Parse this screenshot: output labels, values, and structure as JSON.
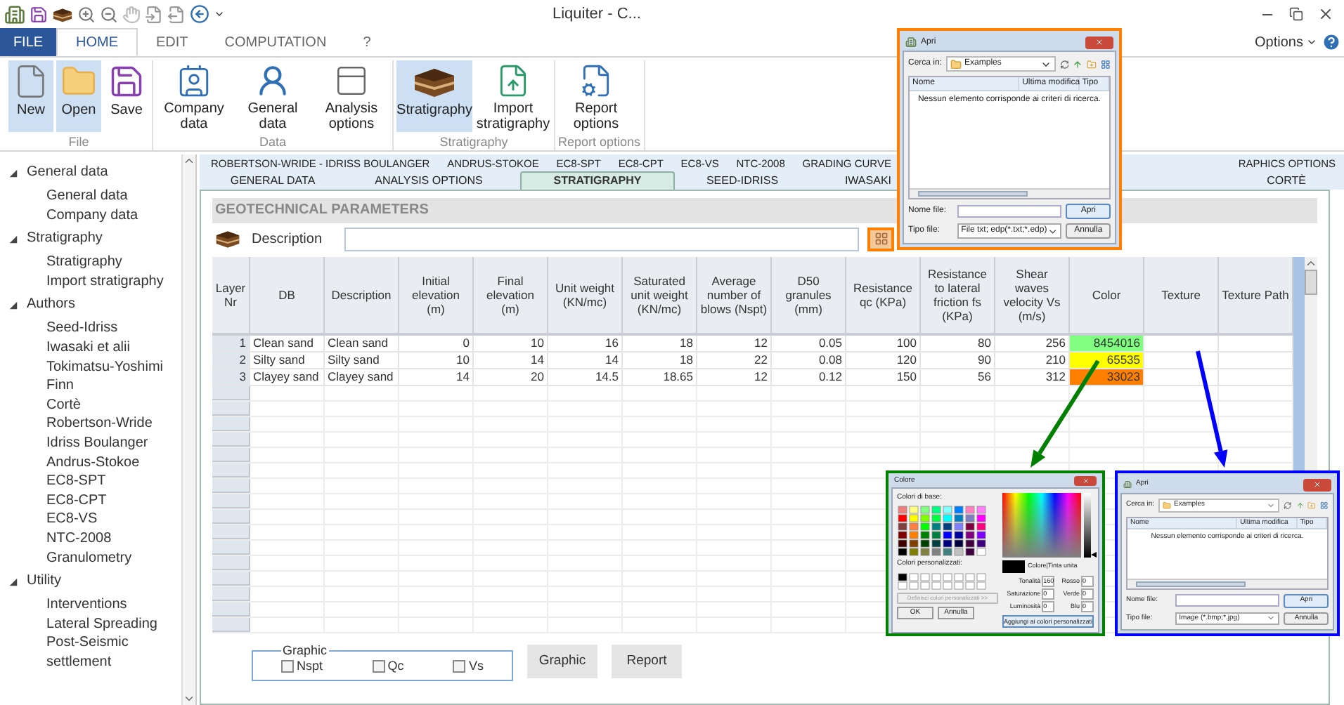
{
  "window": {
    "title": "Liquiter - C..."
  },
  "ribbon_tabs": [
    {
      "label": "FILE",
      "kind": "file",
      "selected": false
    },
    {
      "label": "HOME",
      "kind": "tab",
      "selected": true
    },
    {
      "label": "EDIT",
      "kind": "tab",
      "selected": false
    },
    {
      "label": "COMPUTATION",
      "kind": "tab",
      "selected": false
    },
    {
      "label": "?",
      "kind": "tab",
      "selected": false
    }
  ],
  "options_menu": "Options",
  "ribbon_groups": [
    {
      "label": "File",
      "buttons": [
        {
          "label": "New",
          "selected": true
        },
        {
          "label": "Open",
          "selected": true
        },
        {
          "label": "Save",
          "selected": false
        }
      ]
    },
    {
      "label": "Data",
      "buttons": [
        {
          "label": "Company data",
          "selected": false
        },
        {
          "label": "General data",
          "selected": false
        },
        {
          "label": "Analysis options",
          "selected": false
        }
      ]
    },
    {
      "label": "Stratigraphy",
      "buttons": [
        {
          "label": "Stratigraphy",
          "selected": true
        },
        {
          "label": "Import stratigraphy",
          "selected": false
        }
      ]
    },
    {
      "label": "Report options",
      "buttons": [
        {
          "label": "Report options",
          "selected": false
        }
      ]
    }
  ],
  "sidebar": [
    {
      "label": "General data",
      "expanded": true,
      "children": [
        {
          "label": "General data"
        },
        {
          "label": "Company data"
        }
      ]
    },
    {
      "label": "Stratigraphy",
      "expanded": true,
      "children": [
        {
          "label": "Stratigraphy"
        },
        {
          "label": "Import stratigraphy"
        }
      ]
    },
    {
      "label": "Authors",
      "expanded": true,
      "children": [
        {
          "label": "Seed-Idriss"
        },
        {
          "label": "Iwasaki et alii"
        },
        {
          "label": "Tokimatsu-Yoshimi"
        },
        {
          "label": "Finn"
        },
        {
          "label": "Cortè"
        },
        {
          "label": "Robertson-Wride Idriss Boulanger"
        },
        {
          "label": "Andrus-Stokoe"
        },
        {
          "label": "EC8-SPT"
        },
        {
          "label": "EC8-CPT"
        },
        {
          "label": "EC8-VS"
        },
        {
          "label": "NTC-2008"
        },
        {
          "label": "Granulometry"
        }
      ]
    },
    {
      "label": "Utility",
      "expanded": true,
      "children": [
        {
          "label": "Interventions"
        },
        {
          "label": "Lateral Spreading"
        },
        {
          "label": "Post-Seismic settlement"
        }
      ]
    }
  ],
  "module_tabs": {
    "rows": [
      {
        "tabs": [
          {
            "label": "ROBERTSON-WRIDE - IDRISS BOULANGER",
            "selected": false
          },
          {
            "label": "ANDRUS-STOKOE",
            "selected": false
          },
          {
            "label": "EC8-SPT",
            "selected": false
          },
          {
            "label": "EC8-CPT",
            "selected": false
          },
          {
            "label": "EC8-VS",
            "selected": false
          },
          {
            "label": "NTC-2008",
            "selected": false
          },
          {
            "label": "GRADING CURVE",
            "selected": false
          },
          {
            "label": "RAPHICS OPTIONS",
            "selected": false
          }
        ]
      },
      {
        "tabs": [
          {
            "label": "GENERAL DATA",
            "selected": false
          },
          {
            "label": "ANALYSIS OPTIONS",
            "selected": false
          },
          {
            "label": "STRATIGRAPHY",
            "selected": true
          },
          {
            "label": "SEED-IDRISS",
            "selected": false
          },
          {
            "label": "IWASAKI",
            "selected": false
          },
          {
            "label": "CORTÈ",
            "selected": false
          }
        ]
      }
    ]
  },
  "section_title": "GEOTECHNICAL PARAMETERS",
  "description": {
    "label": "Description"
  },
  "table": {
    "columns": [
      "Layer Nr",
      "DB",
      "Description",
      "Initial elevation (m)",
      "Final elevation (m)",
      "Unit weight (KN/mc)",
      "Saturated unit weight (KN/mc)",
      "Average number of blows (Nspt)",
      "D50 granules (mm)",
      "Resistance qc (KPa)",
      "Resistance to lateral friction fs (KPa)",
      "Shear waves velocity Vs (m/s)",
      "Color",
      "Texture",
      "Texture Path"
    ],
    "rows": [
      {
        "cells": [
          "1",
          "Clean sand",
          "Clean sand",
          "0",
          "10",
          "16",
          "18",
          "12",
          "0.05",
          "100",
          "80",
          "256",
          "8454016"
        ],
        "color": "#80ff80"
      },
      {
        "cells": [
          "2",
          "Silty sand",
          "Silty sand",
          "10",
          "14",
          "14",
          "18",
          "22",
          "0.08",
          "120",
          "90",
          "210",
          "65535"
        ],
        "color": "#ffff00"
      },
      {
        "cells": [
          "3",
          "Clayey sand",
          "Clayey sand",
          "14",
          "20",
          "14.5",
          "18.65",
          "12",
          "0.12",
          "150",
          "56",
          "312",
          "33023"
        ],
        "color": "#ff8000"
      }
    ]
  },
  "graphic_group": {
    "title": "Graphic",
    "checks": [
      {
        "label": "Nspt",
        "checked": false
      },
      {
        "label": "Qc",
        "checked": false
      },
      {
        "label": "Vs",
        "checked": false
      }
    ]
  },
  "buttons": [
    "Graphic",
    "Report"
  ],
  "dialogs": [
    {
      "kind": "open",
      "color": "#ff8000",
      "title": "Apri",
      "look_in_label": "Cerca in:",
      "folder": "Examples",
      "columns": [
        "Nome",
        "Ultima modifica",
        "Tipo"
      ],
      "empty_message": "Nessun elemento corrisponde ai criteri di ricerca.",
      "filename_label": "Nome file:",
      "filetype_label": "Tipo file:",
      "filetype": "File txt; edp(*.txt;*.edp)",
      "buttons": [
        "Apri",
        "Annulla"
      ]
    },
    {
      "kind": "color",
      "color": "#008000",
      "title": "Colore",
      "basic_label": "Colori di base:",
      "custom_label": "Colori personalizzati:",
      "define_button": "Definisci colori personalizzati >>",
      "buttons": [
        "OK",
        "Annulla"
      ],
      "preview_label": "Colore|Tinta unita",
      "level": 0,
      "fields": [
        {
          "label": "Tonalità",
          "value": "160"
        },
        {
          "label": "Rosso",
          "value": "0"
        },
        {
          "label": "Saturazione",
          "value": "0"
        },
        {
          "label": "Verde",
          "value": "0"
        },
        {
          "label": "Luminosità",
          "value": "0"
        },
        {
          "label": "Blu",
          "value": "0"
        }
      ],
      "add_button": "Aggiungi ai colori personalizzati"
    },
    {
      "kind": "open",
      "color": "#0000ff",
      "title": "Apri",
      "look_in_label": "Cerca in:",
      "folder": "Examples",
      "columns": [
        "Nome",
        "Ultima modifica",
        "Tipo"
      ],
      "empty_message": "Nessun elemento corrisponde ai criteri di ricerca.",
      "filename_label": "Nome file:",
      "filetype_label": "Tipo file:",
      "filetype": "Image (*.bmp;*.jpg)",
      "buttons": [
        "Apri",
        "Annulla"
      ]
    }
  ]
}
